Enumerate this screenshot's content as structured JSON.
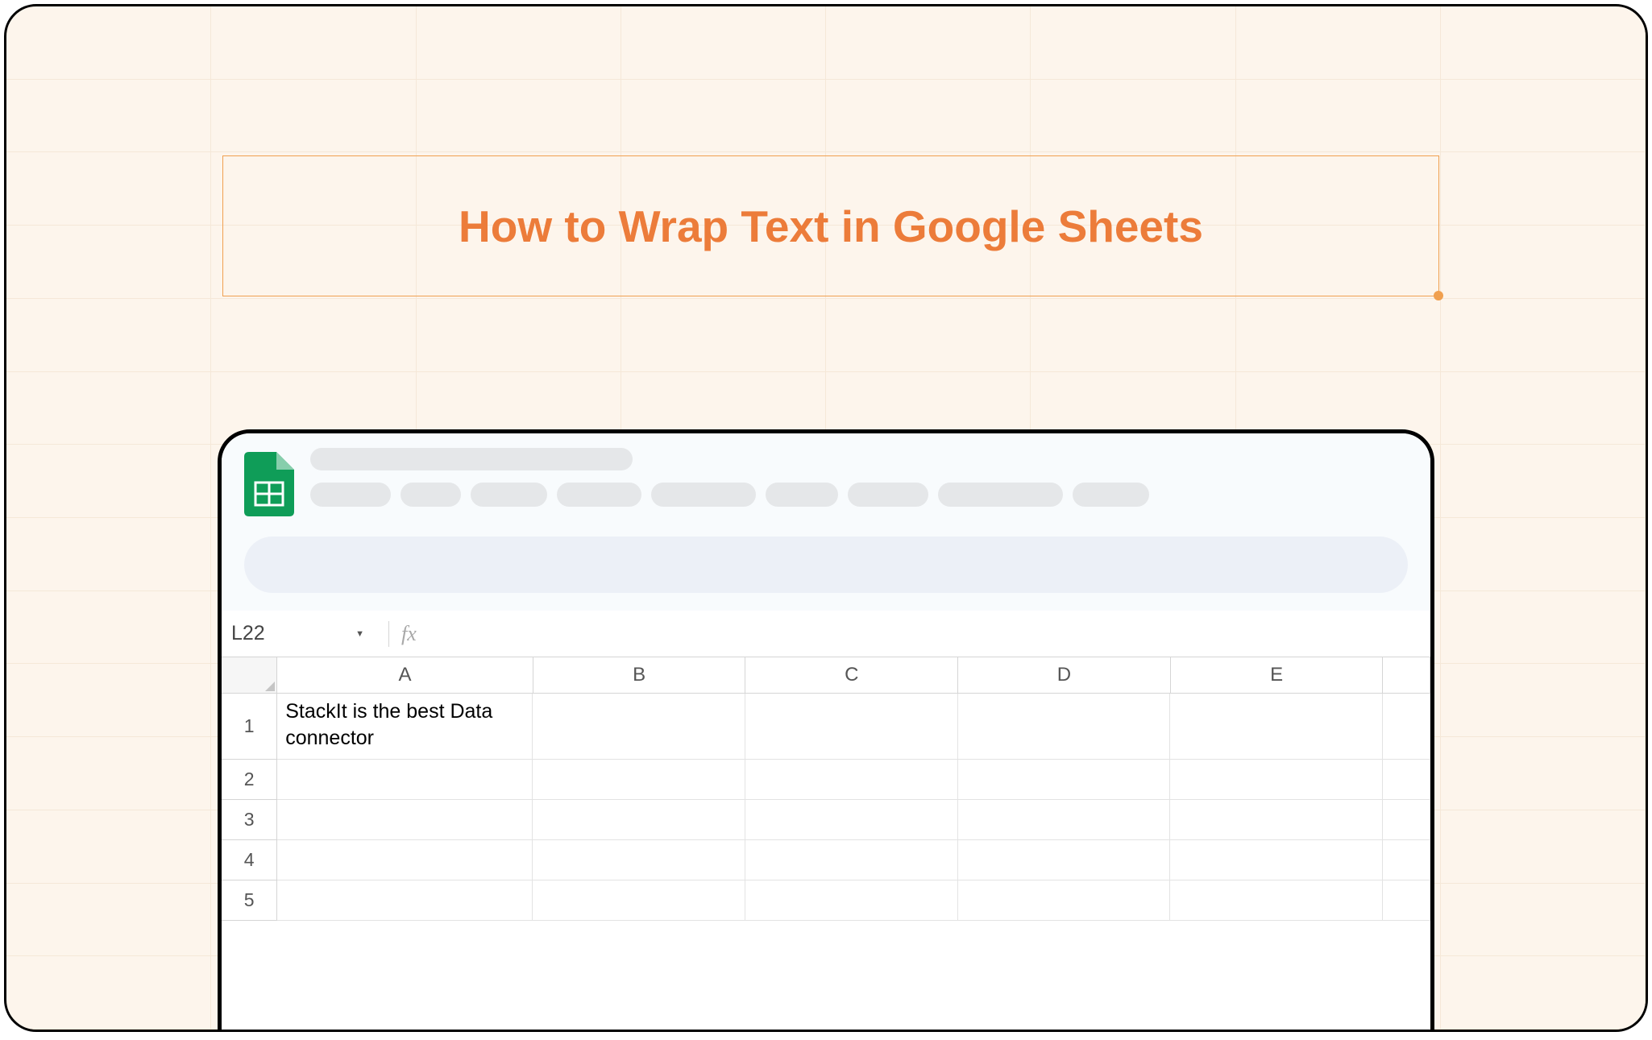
{
  "title": "How to Wrap Text in Google Sheets",
  "name_box": "L22",
  "fx_label": "fx",
  "columns": [
    "A",
    "B",
    "C",
    "D",
    "E"
  ],
  "rows": [
    {
      "num": "1",
      "cells": [
        "StackIt is the best Data connector",
        "",
        "",
        "",
        ""
      ]
    },
    {
      "num": "2",
      "cells": [
        "",
        "",
        "",
        "",
        ""
      ]
    },
    {
      "num": "3",
      "cells": [
        "",
        "",
        "",
        "",
        ""
      ]
    },
    {
      "num": "4",
      "cells": [
        "",
        "",
        "",
        "",
        ""
      ]
    },
    {
      "num": "5",
      "cells": [
        "",
        "",
        "",
        "",
        ""
      ]
    }
  ]
}
